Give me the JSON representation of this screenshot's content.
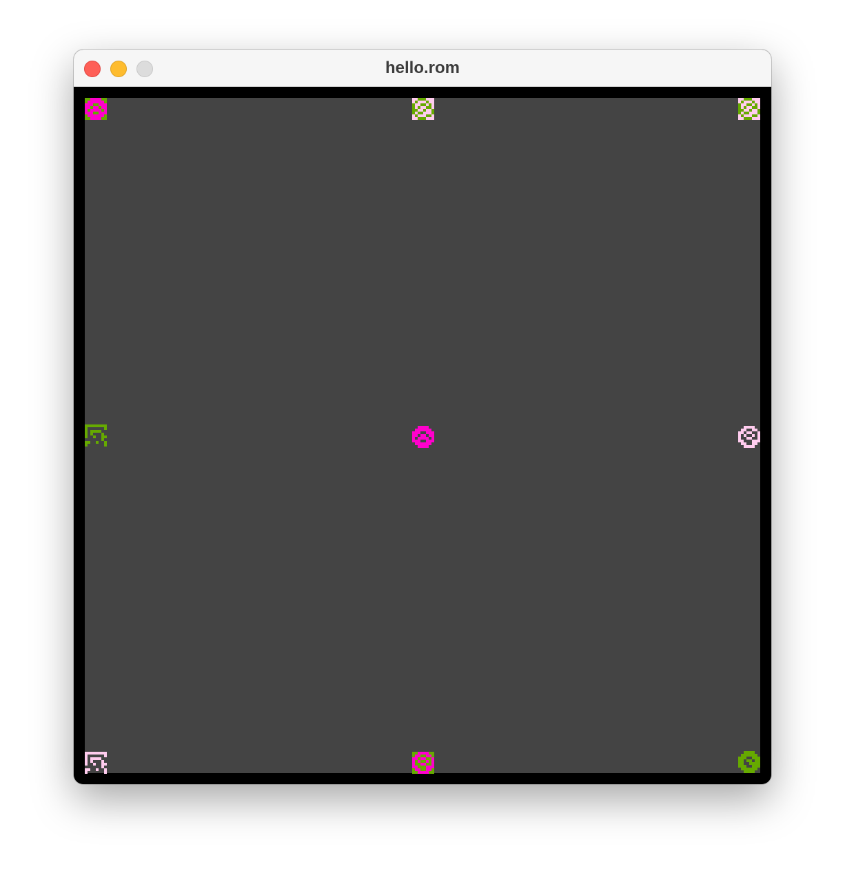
{
  "window": {
    "title": "hello.rom"
  },
  "palette": {
    "background": "#444444",
    "border": "#000000",
    "magenta": "#ff00cc",
    "green": "#66aa00",
    "pink": "#ffccee"
  },
  "sprites": [
    {
      "name": "sprite-top-left",
      "fg": "#ff00cc",
      "bg": "#66aa00",
      "glyph": "orb-a"
    },
    {
      "name": "sprite-top-center",
      "fg": "#66aa00",
      "bg": "#ffccee",
      "glyph": "orb-b"
    },
    {
      "name": "sprite-top-right",
      "fg": "#66aa00",
      "bg": "#ffccee",
      "glyph": "orb-b"
    },
    {
      "name": "sprite-middle-left",
      "fg": "#66aa00",
      "bg": null,
      "glyph": "orb-c"
    },
    {
      "name": "sprite-center",
      "fg": "#ff00cc",
      "bg": null,
      "glyph": "orb-a"
    },
    {
      "name": "sprite-middle-right",
      "fg": "#ffccee",
      "bg": null,
      "glyph": "orb-d"
    },
    {
      "name": "sprite-bottom-left",
      "fg": "#ffccee",
      "bg": null,
      "glyph": "orb-c"
    },
    {
      "name": "sprite-bottom-center",
      "fg": "#ff00cc",
      "bg": "#66aa00",
      "glyph": "orb-d"
    },
    {
      "name": "sprite-bottom-right",
      "fg": "#66aa00",
      "bg": null,
      "glyph": "orb-e"
    }
  ]
}
